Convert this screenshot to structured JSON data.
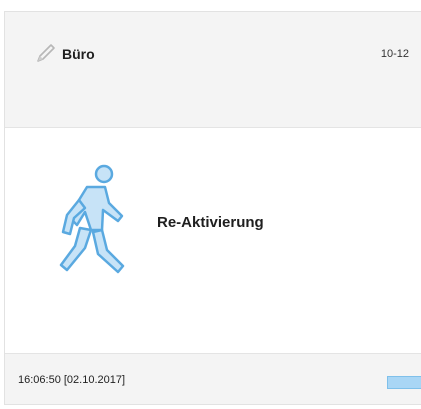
{
  "card": {
    "title": "Büro",
    "code": "10-12",
    "status": "Re-Aktivierung",
    "timestamp": "16:06:50 [02.10.2017]",
    "icons": {
      "edit": "pencil-icon",
      "status": "walking-person-icon"
    },
    "colors": {
      "accent": "#5aa9e0",
      "indicator": "#a9d6f5",
      "header_bg": "#f4f4f4"
    }
  }
}
